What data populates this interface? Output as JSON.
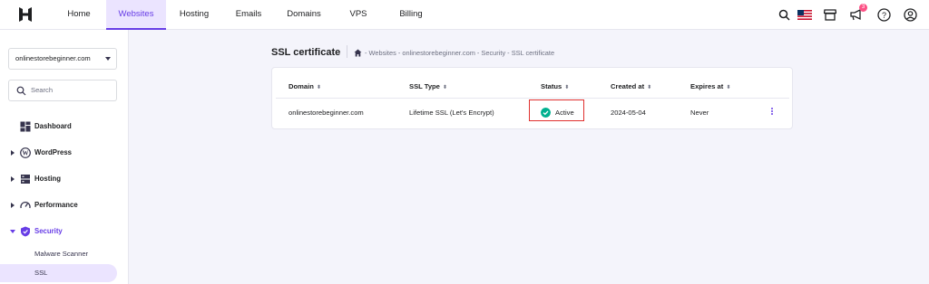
{
  "nav": {
    "tabs": [
      {
        "label": "Home"
      },
      {
        "label": "Websites"
      },
      {
        "label": "Hosting"
      },
      {
        "label": "Emails"
      },
      {
        "label": "Domains"
      },
      {
        "label": "VPS"
      },
      {
        "label": "Billing"
      }
    ],
    "active_tab": "Websites",
    "notification_count": "3"
  },
  "sidebar": {
    "domain_select": "onlinestorebeginner.com",
    "search_placeholder": "Search",
    "items": [
      {
        "label": "Dashboard"
      },
      {
        "label": "WordPress"
      },
      {
        "label": "Hosting"
      },
      {
        "label": "Performance"
      },
      {
        "label": "Security"
      }
    ],
    "security_sub": [
      {
        "label": "Malware Scanner"
      },
      {
        "label": "SSL"
      }
    ]
  },
  "main": {
    "title": "SSL certificate",
    "breadcrumb": "- Websites - onlinestorebeginner.com - Security - SSL certificate",
    "table": {
      "headers": [
        "Domain",
        "SSL Type",
        "Status",
        "Created at",
        "Expires at"
      ],
      "rows": [
        {
          "domain": "onlinestorebeginner.com",
          "ssl_type": "Lifetime SSL (Let's Encrypt)",
          "status": "Active",
          "created": "2024-05-04",
          "expires": "Never"
        }
      ]
    }
  },
  "colors": {
    "accent": "#673de6",
    "accent_light": "#ebe4ff",
    "status_active": "#00b090",
    "highlight_border": "#e0302e"
  }
}
